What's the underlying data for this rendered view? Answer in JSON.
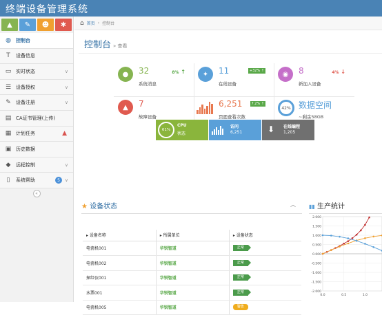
{
  "app": {
    "title": "终端设备管理系统"
  },
  "shortcuts": [
    {
      "icon": "signal-icon",
      "color": "#86b451"
    },
    {
      "icon": "pencil-icon",
      "color": "#5aa0d9"
    },
    {
      "icon": "users-icon",
      "color": "#f0a030"
    },
    {
      "icon": "cogs-icon",
      "color": "#e05a4f"
    }
  ],
  "sidebar": {
    "items": [
      {
        "label": "控制台",
        "icon": "dashboard-icon",
        "glyph": "◍",
        "active": true
      },
      {
        "label": "设备信息",
        "icon": "text-icon",
        "glyph": "T"
      },
      {
        "label": "实时状态",
        "icon": "desktop-icon",
        "glyph": "▭",
        "chevron": true
      },
      {
        "label": "设备授权",
        "icon": "list-icon",
        "glyph": "☰",
        "chevron": true
      },
      {
        "label": "设备注册",
        "icon": "edit-icon",
        "glyph": "✎",
        "chevron": true
      },
      {
        "label": "CA证书管理(上传)",
        "icon": "certificate-icon",
        "glyph": "▤"
      },
      {
        "label": "计划任务",
        "icon": "calendar-icon",
        "glyph": "▦",
        "warn": true
      },
      {
        "label": "历史数据",
        "icon": "picture-icon",
        "glyph": "▣"
      },
      {
        "label": "远程控制",
        "icon": "tag-icon",
        "glyph": "◆",
        "chevron": true
      },
      {
        "label": "系统帮助",
        "icon": "file-icon",
        "glyph": "▯",
        "badge": "5",
        "chevron": true
      }
    ]
  },
  "breadcrumb": {
    "home": "首页",
    "current": "控制台"
  },
  "page": {
    "title": "控制台",
    "subtitle": "查看"
  },
  "stats": [
    {
      "value": "32",
      "label": "系统消息",
      "change": "8%",
      "trend": "up",
      "icon": "comments-icon",
      "glyph": "●",
      "color": "#86b451",
      "box": false
    },
    {
      "value": "11",
      "label": "在线设备",
      "change": "+32%",
      "trend": "up",
      "icon": "twitter-icon",
      "glyph": "✦",
      "color": "#5aa0d9",
      "box": true
    },
    {
      "value": "8",
      "label": "新加入设备",
      "change": "4%",
      "trend": "down",
      "icon": "cart-icon",
      "glyph": "◉",
      "color": "#c56fc9",
      "box": false
    },
    {
      "value": "7",
      "label": "故障设备",
      "change": "",
      "icon": "flask-icon",
      "glyph": "▲",
      "color": "#e05a4f"
    },
    {
      "value": "6,251",
      "label": "页面查看次数",
      "change": "7.2%",
      "trend": "up",
      "icon": "bars-icon",
      "color": "#e8784f",
      "box": true
    },
    {
      "value": "数据空间",
      "label": "~剩余58GB",
      "ring": "42%",
      "icon": "disk-icon",
      "color": "#5aa0d9"
    }
  ],
  "tiles": [
    {
      "title": "CPU",
      "sub": "状态",
      "ring": "61%",
      "color": "#8ab53c"
    },
    {
      "title": "访问",
      "sub": "6,251",
      "color": "#5aa0d9"
    },
    {
      "title": "在线编程",
      "sub": "1,205",
      "color": "#707070"
    }
  ],
  "device_status": {
    "title": "设备状态",
    "columns": [
      "设备名称",
      "所属单位",
      "设备状态"
    ],
    "rows": [
      {
        "name": "电瓷机001",
        "unit": "华锐智道",
        "status": "正常",
        "warn": false
      },
      {
        "name": "电瓷机002",
        "unit": "华锐智道",
        "status": "正常",
        "warn": false
      },
      {
        "name": "探红仪001",
        "unit": "华锐智道",
        "status": "正常",
        "warn": false
      },
      {
        "name": "水票001",
        "unit": "华锐智道",
        "status": "正常",
        "warn": false
      },
      {
        "name": "电瓷机005",
        "unit": "华锐智道",
        "status": "警告",
        "warn": true
      }
    ]
  },
  "production": {
    "title": "生产统计"
  },
  "chart_data": {
    "type": "line",
    "yticks": [
      "2.000",
      "1.500",
      "1.000",
      "0.500",
      "0.000",
      "-0.500",
      "-1.000",
      "-1.500",
      "-2.000"
    ],
    "xticks": [
      "0.0",
      "0.5",
      "1.0"
    ],
    "ylim": [
      -2,
      2
    ],
    "xlim": [
      0,
      1.4
    ],
    "series": [
      {
        "color": "#c03030",
        "x": [
          0,
          0.1,
          0.2,
          0.3,
          0.4,
          0.5,
          0.6,
          0.7,
          0.8,
          0.9,
          1.0,
          1.1,
          1.2
        ],
        "values": [
          0,
          0.1,
          0.2,
          0.31,
          0.42,
          0.55,
          0.68,
          0.84,
          1.03,
          1.26,
          1.56,
          1.96,
          2.5
        ]
      },
      {
        "color": "#f0a030",
        "x": [
          0,
          0.2,
          0.4,
          0.6,
          0.8,
          1.0,
          1.2,
          1.4
        ],
        "values": [
          0,
          0.2,
          0.39,
          0.56,
          0.72,
          0.84,
          0.93,
          0.99
        ]
      },
      {
        "color": "#5aa0d9",
        "x": [
          0,
          0.2,
          0.4,
          0.6,
          0.8,
          1.0,
          1.2,
          1.4
        ],
        "values": [
          1,
          0.98,
          0.92,
          0.83,
          0.7,
          0.54,
          0.36,
          0.17
        ]
      }
    ]
  }
}
